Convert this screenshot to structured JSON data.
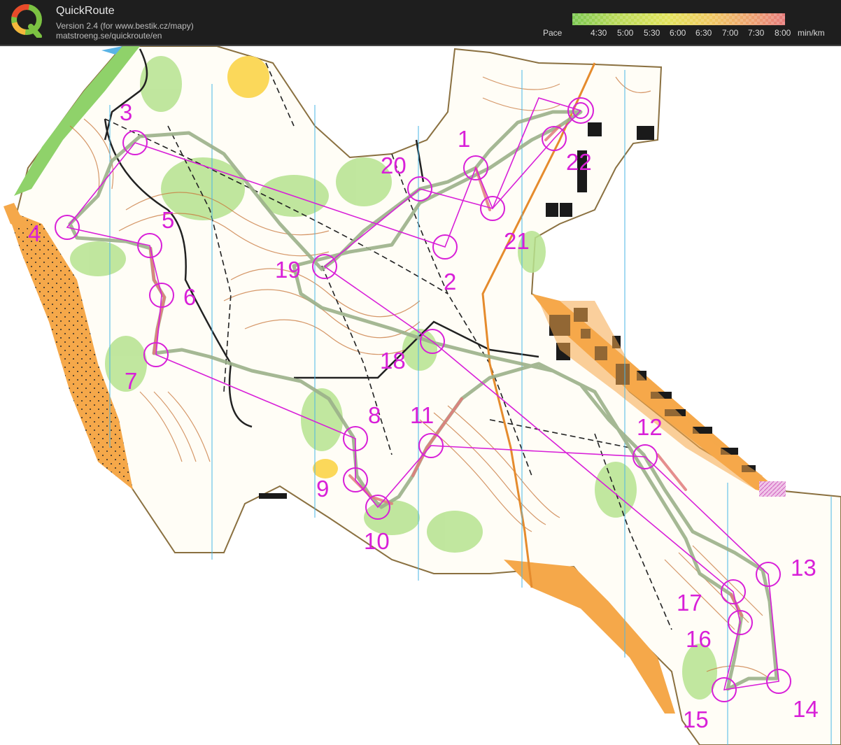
{
  "app": {
    "name": "QuickRoute",
    "version_line": "Version 2.4  (for www.bestik.cz/mapy)",
    "url_line": "matstroeng.se/quickroute/en"
  },
  "pace_legend": {
    "title": "Pace",
    "ticks": [
      "4:30",
      "5:00",
      "5:30",
      "6:00",
      "6:30",
      "7:00",
      "7:30",
      "8:00"
    ],
    "unit": "min/km",
    "colors": [
      "#7ac74f",
      "#b7d957",
      "#e2e35a",
      "#f0c860",
      "#eea070",
      "#e67a7a"
    ]
  },
  "course": {
    "color": "#d81fd8",
    "controls": [
      {
        "label": "1"
      },
      {
        "label": "2"
      },
      {
        "label": "3"
      },
      {
        "label": "4"
      },
      {
        "label": "5"
      },
      {
        "label": "6"
      },
      {
        "label": "7"
      },
      {
        "label": "8"
      },
      {
        "label": "9"
      },
      {
        "label": "10"
      },
      {
        "label": "11"
      },
      {
        "label": "12"
      },
      {
        "label": "13"
      },
      {
        "label": "14"
      },
      {
        "label": "15"
      },
      {
        "label": "16"
      },
      {
        "label": "17"
      },
      {
        "label": "18"
      },
      {
        "label": "19"
      },
      {
        "label": "20"
      },
      {
        "label": "21"
      },
      {
        "label": "22"
      }
    ]
  }
}
